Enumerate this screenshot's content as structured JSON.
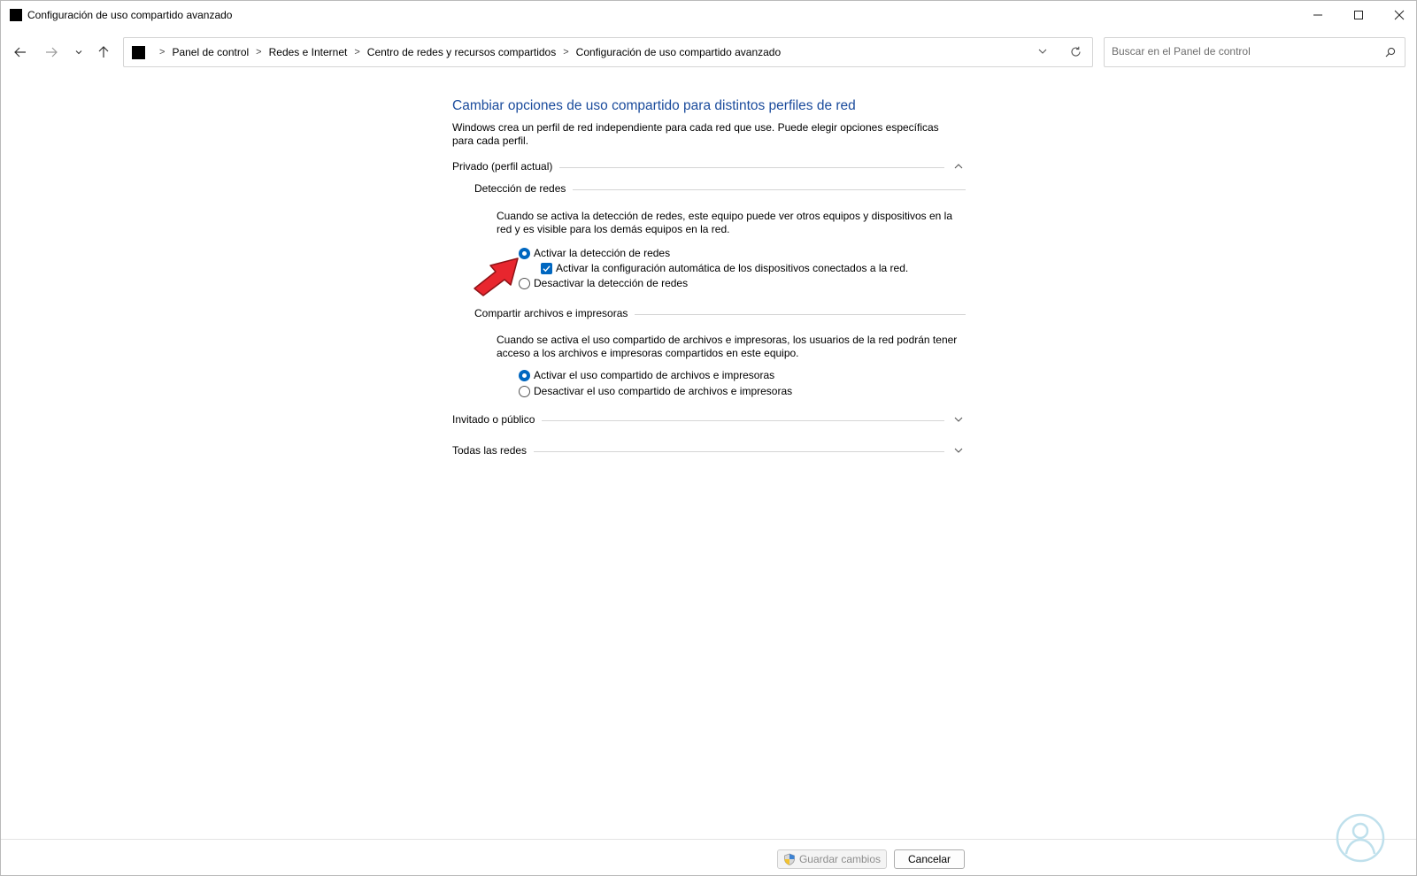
{
  "window": {
    "title": "Configuración de uso compartido avanzado"
  },
  "address": {
    "breadcrumbs": [
      "Panel de control",
      "Redes e Internet",
      "Centro de redes y recursos compartidos",
      "Configuración de uso compartido avanzado"
    ]
  },
  "search": {
    "placeholder": "Buscar en el Panel de control"
  },
  "content": {
    "title": "Cambiar opciones de uso compartido para distintos perfiles de red",
    "description": "Windows crea un perfil de red independiente para cada red que use. Puede elegir opciones específicas para cada perfil.",
    "private": {
      "label": "Privado (perfil actual)",
      "discovery": {
        "label": "Detección de redes",
        "text": "Cuando se activa la detección de redes, este equipo puede ver otros equipos y dispositivos en la red y es visible para los demás equipos en la red.",
        "on_label": "Activar la detección de redes",
        "auto_label": "Activar la configuración automática de los dispositivos conectados a la red.",
        "off_label": "Desactivar la detección de redes",
        "selected": "on",
        "auto_checked": true
      },
      "sharing": {
        "label": "Compartir archivos e impresoras",
        "text": "Cuando se activa el uso compartido de archivos e impresoras, los usuarios de la red podrán tener acceso a los archivos e impresoras compartidos en este equipo.",
        "on_label": "Activar el uso compartido de archivos e impresoras",
        "off_label": "Desactivar el uso compartido de archivos e impresoras",
        "selected": "on"
      }
    },
    "guest": {
      "label": "Invitado o público"
    },
    "all": {
      "label": "Todas las redes"
    }
  },
  "footer": {
    "save_label": "Guardar cambios",
    "cancel_label": "Cancelar"
  },
  "colors": {
    "accent": "#0067c0",
    "title": "#1a4b9c",
    "annotation_arrow": "#e8262e"
  }
}
